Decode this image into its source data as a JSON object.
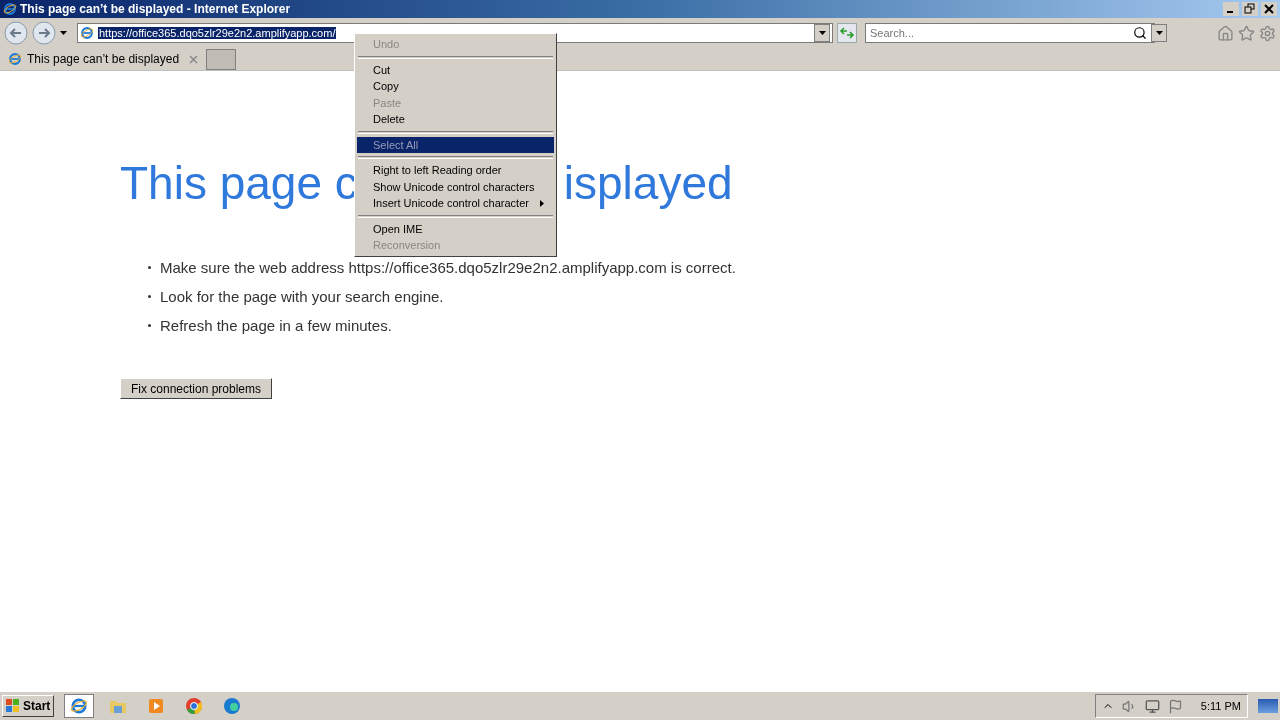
{
  "window": {
    "title": "This page can’t be displayed - Internet Explorer"
  },
  "address_bar": {
    "value": "https://office365.dqo5zlr29e2n2.amplifyapp.com/",
    "text_selected": true
  },
  "search": {
    "placeholder": "Search..."
  },
  "tabs": [
    {
      "label": "This page can’t be displayed",
      "selected": true
    }
  ],
  "page": {
    "heading_left": "This page c",
    "heading_right": "isplayed",
    "bullets": [
      "Make sure the web address https://office365.dqo5zlr29e2n2.amplifyapp.com is correct.",
      "Look for the page with your search engine.",
      "Refresh the page in a few minutes."
    ],
    "button": "Fix connection problems"
  },
  "context_menu": [
    {
      "kind": "item",
      "label": "Undo",
      "disabled": true,
      "selected": false,
      "submenu": false
    },
    {
      "kind": "separator"
    },
    {
      "kind": "item",
      "label": "Cut",
      "disabled": false,
      "selected": false,
      "submenu": false
    },
    {
      "kind": "item",
      "label": "Copy",
      "disabled": false,
      "selected": false,
      "submenu": false
    },
    {
      "kind": "item",
      "label": "Paste",
      "disabled": true,
      "selected": false,
      "submenu": false
    },
    {
      "kind": "item",
      "label": "Delete",
      "disabled": false,
      "selected": false,
      "submenu": false
    },
    {
      "kind": "separator"
    },
    {
      "kind": "item",
      "label": "Select All",
      "disabled": true,
      "selected": true,
      "submenu": false
    },
    {
      "kind": "separator"
    },
    {
      "kind": "item",
      "label": "Right to left Reading order",
      "disabled": false,
      "selected": false,
      "submenu": false
    },
    {
      "kind": "item",
      "label": "Show Unicode control characters",
      "disabled": false,
      "selected": false,
      "submenu": false
    },
    {
      "kind": "item",
      "label": "Insert Unicode control character",
      "disabled": false,
      "selected": false,
      "submenu": true
    },
    {
      "kind": "separator"
    },
    {
      "kind": "item",
      "label": "Open IME",
      "disabled": false,
      "selected": false,
      "submenu": false
    },
    {
      "kind": "item",
      "label": "Reconversion",
      "disabled": true,
      "selected": false,
      "submenu": false
    }
  ],
  "taskbar": {
    "start": "Start",
    "clock": "5:11 PM"
  }
}
